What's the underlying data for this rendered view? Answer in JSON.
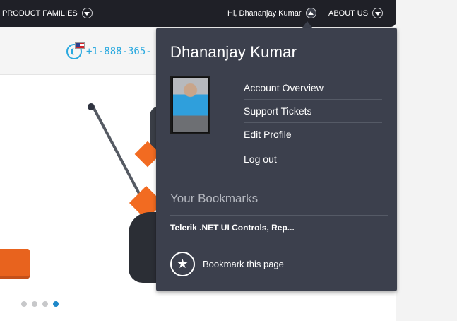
{
  "nav": {
    "product_families": "PRODUCT FAMILIES",
    "greeting": "Hi, Dhananjay Kumar",
    "about_us": "ABOUT US"
  },
  "contact": {
    "phone": "+1-888-365-"
  },
  "user_menu": {
    "name": "Dhananjay Kumar",
    "items": [
      {
        "label": "Account Overview"
      },
      {
        "label": "Support Tickets"
      },
      {
        "label": "Edit Profile"
      },
      {
        "label": "Log out"
      }
    ],
    "bookmarks_title": "Your Bookmarks",
    "bookmarks": [
      {
        "label": "Telerik .NET UI Controls, Rep..."
      }
    ],
    "bookmark_this_page": "Bookmark this page"
  },
  "carousel": {
    "total_slides": 4,
    "active_slide": 4
  },
  "colors": {
    "nav_bg": "#1f2027",
    "dropdown_bg": "#3c404d",
    "accent_orange": "#f26b21",
    "accent_blue": "#2aa9df",
    "active_dot": "#1e88c9"
  },
  "icons": [
    "chevron-down-icon",
    "chevron-up-icon",
    "phone-icon",
    "us-flag-icon",
    "star-add-icon"
  ]
}
